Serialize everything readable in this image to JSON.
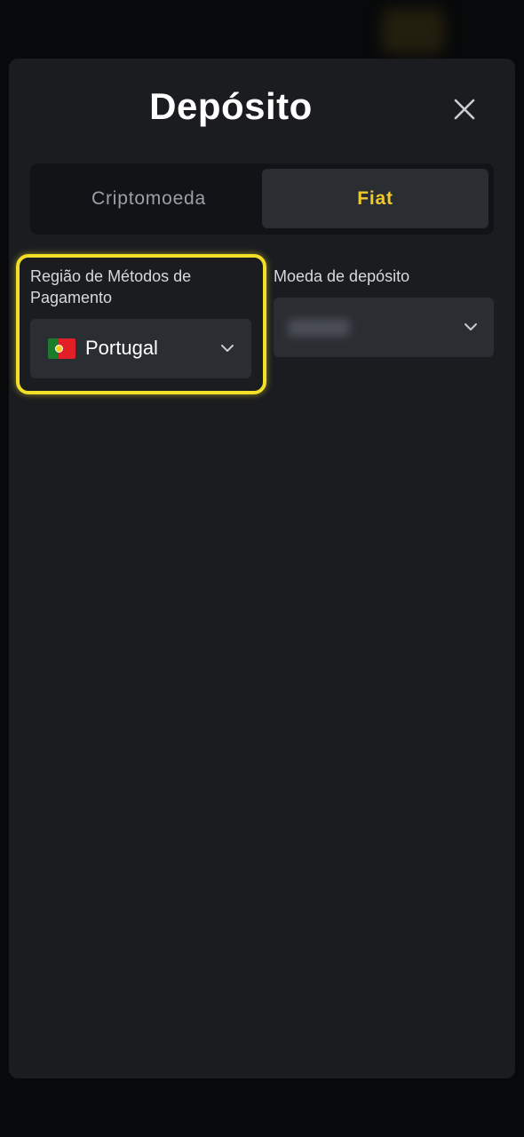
{
  "modal": {
    "title": "Depósito",
    "close_icon": "close-icon"
  },
  "tabs": [
    {
      "label": "Criptomoeda",
      "active": false
    },
    {
      "label": "Fiat",
      "active": true
    }
  ],
  "region_field": {
    "label": "Região de Métodos de Pagamento",
    "selected": "Portugal",
    "flag_icon": "portugal-flag-icon",
    "highlight_color": "#f2df29"
  },
  "currency_field": {
    "label": "Moeda de depósito"
  },
  "colors": {
    "accent": "#f0c92a",
    "modal_bg": "#1a1c20",
    "input_bg": "#2a2d32"
  }
}
